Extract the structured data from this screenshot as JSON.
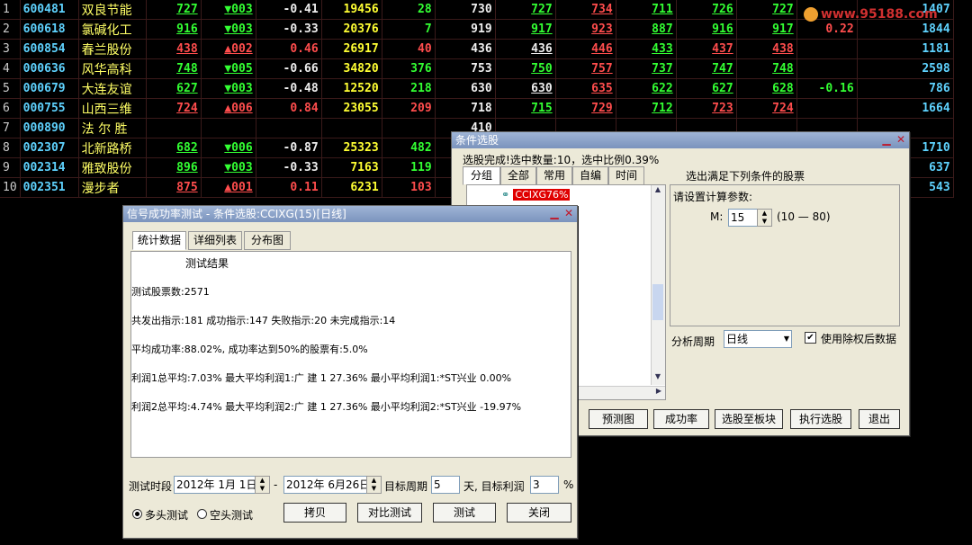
{
  "rows": [
    {
      "idx": "1",
      "code": "600481",
      "name": "双良节能",
      "price": "727",
      "chg": "▼003",
      "pct": "-0.41",
      "vol": "19456",
      "cur": "28",
      "prev": "730",
      "open": "727",
      "high": "734",
      "low": "711",
      "bid": "726",
      "ask": "727",
      "extra": "",
      "amt": "1407"
    },
    {
      "idx": "2",
      "code": "600618",
      "name": "氯碱化工",
      "price": "916",
      "chg": "▼003",
      "pct": "-0.33",
      "vol": "20376",
      "cur": "7",
      "prev": "919",
      "open": "917",
      "high": "923",
      "low": "887",
      "bid": "916",
      "ask": "917",
      "extra": "0.22",
      "amt": "1844"
    },
    {
      "idx": "3",
      "code": "600854",
      "name": "春兰股份",
      "price": "438",
      "chg": "▲002",
      "pct": "0.46",
      "vol": "26917",
      "cur": "40",
      "prev": "436",
      "open": "436",
      "high": "446",
      "low": "433",
      "bid": "437",
      "ask": "438",
      "extra": "",
      "amt": "1181"
    },
    {
      "idx": "4",
      "code": "000636",
      "name": "风华高科",
      "price": "748",
      "chg": "▼005",
      "pct": "-0.66",
      "vol": "34820",
      "cur": "376",
      "prev": "753",
      "open": "750",
      "high": "757",
      "low": "737",
      "bid": "747",
      "ask": "748",
      "extra": "",
      "amt": "2598"
    },
    {
      "idx": "5",
      "code": "000679",
      "name": "大连友谊",
      "price": "627",
      "chg": "▼003",
      "pct": "-0.48",
      "vol": "12520",
      "cur": "218",
      "prev": "630",
      "open": "630",
      "high": "635",
      "low": "622",
      "bid": "627",
      "ask": "628",
      "extra": "-0.16",
      "amt": "786"
    },
    {
      "idx": "6",
      "code": "000755",
      "name": "山西三维",
      "price": "724",
      "chg": "▲006",
      "pct": "0.84",
      "vol": "23055",
      "cur": "209",
      "prev": "718",
      "open": "715",
      "high": "729",
      "low": "712",
      "bid": "723",
      "ask": "724",
      "extra": "",
      "amt": "1664"
    },
    {
      "idx": "7",
      "code": "000890",
      "name": "法 尔 胜",
      "price": "",
      "chg": "",
      "pct": "",
      "vol": "",
      "cur": "",
      "prev": "410",
      "open": "",
      "high": "",
      "low": "",
      "bid": "",
      "ask": "",
      "extra": "",
      "amt": ""
    },
    {
      "idx": "8",
      "code": "002307",
      "name": "北新路桥",
      "price": "682",
      "chg": "▼006",
      "pct": "-0.87",
      "vol": "25323",
      "cur": "482",
      "prev": "",
      "open": "",
      "high": "",
      "low": "",
      "bid": "",
      "ask": "",
      "extra": "",
      "amt": "1710"
    },
    {
      "idx": "9",
      "code": "002314",
      "name": "雅致股份",
      "price": "896",
      "chg": "▼003",
      "pct": "-0.33",
      "vol": "7163",
      "cur": "119",
      "prev": "",
      "open": "",
      "high": "",
      "low": "",
      "bid": "",
      "ask": "",
      "extra": "",
      "amt": "637"
    },
    {
      "idx": "10",
      "code": "002351",
      "name": "漫步者",
      "price": "875",
      "chg": "▲001",
      "pct": "0.11",
      "vol": "6231",
      "cur": "103",
      "prev": "",
      "open": "",
      "high": "",
      "low": "",
      "bid": "",
      "ask": "",
      "extra": "",
      "amt": "543"
    }
  ],
  "watermark": "www.95188.com",
  "selector": {
    "title": "条件选股",
    "status": "选股完成!选中数量:10，选中比例0.39%",
    "tabs": [
      "分组",
      "全部",
      "常用",
      "自编",
      "时间"
    ],
    "heading": "选出满足下列条件的股票",
    "tree_item": "CCIXG76%",
    "params_label": "请设置计算参数:",
    "param_name": "M:",
    "param_value": "15",
    "param_range": "(10 — 80)",
    "period_label": "分析周期",
    "period_value": "日线",
    "exright_label": "使用除权后数据",
    "buttons": [
      "预测图",
      "成功率",
      "选股至板块",
      "执行选股",
      "退出"
    ]
  },
  "signal": {
    "title": "信号成功率测试 - 条件选股:CCIXG(15)[日线]",
    "tabs": [
      "统计数据",
      "详细列表",
      "分布图"
    ],
    "result_title": "测试结果",
    "lines": [
      "测试股票数:2571",
      "共发出指示:181 成功指示:147 失败指示:20 未完成指示:14",
      "平均成功率:88.02%, 成功率达到50%的股票有:5.0%",
      "利润1总平均:7.03% 最大平均利润1:广  建 1 27.36% 最小平均利润1:*ST兴业  0.00%",
      "利润2总平均:4.74% 最大平均利润2:广  建 1 27.36% 最小平均利润2:*ST兴业  -19.97%"
    ],
    "period_label": "测试时段",
    "start_date": "2012年 1月 1日",
    "end_date": "2012年 6月26日",
    "dash": "-",
    "target_period_label": "目标周期",
    "target_period": "5",
    "target_profit_label": "天, 目标利润",
    "target_profit": "3",
    "percent": "%",
    "radio_long": "多头测试",
    "radio_short": "空头测试",
    "buttons": [
      "拷贝",
      "对比测试",
      "测试",
      "关闭"
    ]
  }
}
